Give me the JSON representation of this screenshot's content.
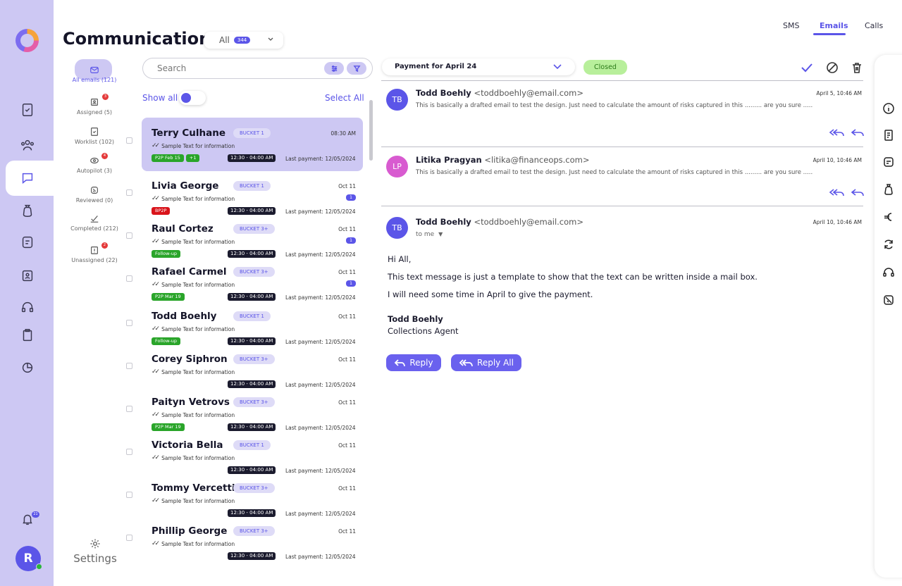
{
  "header": {
    "title": "Communication",
    "filter": {
      "value": "All",
      "count": "344"
    },
    "tabs": [
      {
        "label": "SMS",
        "active": false
      },
      {
        "label": "Emails",
        "active": true
      },
      {
        "label": "Calls",
        "active": false
      }
    ]
  },
  "rail": {
    "items": [
      "tasks-icon",
      "users-icon",
      "chat-icon",
      "money-bag-icon",
      "note-icon",
      "badge-icon",
      "headset-icon",
      "clipboard-icon",
      "pie-chart-icon"
    ],
    "active": "chat-icon",
    "notifications_count": "21",
    "user_initial": "R"
  },
  "folders": [
    {
      "label": "All emails (121)",
      "icon": "mail-icon",
      "active": true,
      "badge": ""
    },
    {
      "label": "Assigned (5)",
      "icon": "assigned-icon",
      "active": false,
      "badge": "3"
    },
    {
      "label": "Worklist (102)",
      "icon": "worklist-icon",
      "active": false,
      "badge": ""
    },
    {
      "label": "Autopilot (3)",
      "icon": "autopilot-icon",
      "active": false,
      "badge": "4"
    },
    {
      "label": "Reviewed (0)",
      "icon": "reviewed-icon",
      "active": false,
      "badge": ""
    },
    {
      "label": "Completed (212)",
      "icon": "check-icon",
      "active": false,
      "badge": ""
    },
    {
      "label": "Unassigned (22)",
      "icon": "unassigned-icon",
      "active": false,
      "badge": "2"
    }
  ],
  "settings_label": "Settings",
  "list": {
    "search_placeholder": "Search",
    "show_all_label": "Show all",
    "select_all_label": "Select All",
    "rows": [
      {
        "name": "Terry Culhane",
        "bucket": "BUCKET 1",
        "time": "08:30 AM",
        "subtitle": "Sample Text for information",
        "tags": [
          {
            "text": "P2P Feb 15",
            "color": "green"
          },
          {
            "text": "+1",
            "color": "green"
          }
        ],
        "slot": "12:30 - 04:00 AM",
        "last_payment": "Last payment: 12/05/2024",
        "unread": "",
        "active": true
      },
      {
        "name": "Livia George",
        "bucket": "BUCKET 1",
        "time": "Oct 11",
        "subtitle": "Sample Text for information",
        "tags": [
          {
            "text": "BP2P",
            "color": "red"
          }
        ],
        "slot": "12:30 - 04:00 AM",
        "last_payment": "Last payment: 12/05/2024",
        "unread": "1",
        "active": false
      },
      {
        "name": "Raul Cortez",
        "bucket": "BUCKET 3+",
        "time": "Oct 11",
        "subtitle": "Sample Text for information",
        "tags": [
          {
            "text": "Follow-up",
            "color": "green"
          }
        ],
        "slot": "12:30 - 04:00 AM",
        "last_payment": "Last payment: 12/05/2024",
        "unread": "1",
        "active": false
      },
      {
        "name": "Rafael Carmel",
        "bucket": "BUCKET 3+",
        "time": "Oct 11",
        "subtitle": "Sample Text for information",
        "tags": [
          {
            "text": "P2P Mar 19",
            "color": "green"
          }
        ],
        "slot": "12:30 - 04:00 AM",
        "last_payment": "Last payment: 12/05/2024",
        "unread": "1",
        "active": false
      },
      {
        "name": "Todd Boehly",
        "bucket": "BUCKET 1",
        "time": "Oct 11",
        "subtitle": "Sample Text for information",
        "tags": [
          {
            "text": "Follow-up",
            "color": "green"
          }
        ],
        "slot": "12:30 - 04:00 AM",
        "last_payment": "Last payment: 12/05/2024",
        "unread": "",
        "active": false
      },
      {
        "name": "Corey Siphron",
        "bucket": "BUCKET 3+",
        "time": "Oct 11",
        "subtitle": "Sample Text for information",
        "tags": [],
        "slot": "12:30 - 04:00 AM",
        "last_payment": "Last payment: 12/05/2024",
        "unread": "",
        "active": false
      },
      {
        "name": "Paityn Vetrovs",
        "bucket": "BUCKET 3+",
        "time": "Oct 11",
        "subtitle": "Sample Text for information",
        "tags": [
          {
            "text": "P2P Mar 19",
            "color": "green"
          }
        ],
        "slot": "12:30 - 04:00 AM",
        "last_payment": "Last payment: 12/05/2024",
        "unread": "",
        "active": false
      },
      {
        "name": "Victoria Bella",
        "bucket": "BUCKET 1",
        "time": "Oct 11",
        "subtitle": "Sample Text for information",
        "tags": [],
        "slot": "12:30 - 04:00 AM",
        "last_payment": "Last payment: 12/05/2024",
        "unread": "",
        "active": false
      },
      {
        "name": "Tommy Vercetti",
        "bucket": "BUCKET 3+",
        "time": "Oct 11",
        "subtitle": "Sample Text for information",
        "tags": [],
        "slot": "12:30 - 04:00 AM",
        "last_payment": "Last payment: 12/05/2024",
        "unread": "",
        "active": false
      },
      {
        "name": "Phillip George",
        "bucket": "BUCKET 3+",
        "time": "Oct 11",
        "subtitle": "Sample Text for information",
        "tags": [],
        "slot": "12:30 - 04:00 AM",
        "last_payment": "Last payment: 12/05/2024",
        "unread": "",
        "active": false
      }
    ]
  },
  "thread": {
    "subject": "Payment for April 24",
    "status": "Closed",
    "messages": [
      {
        "initials": "TB",
        "name": "Todd Boehly",
        "email": "<toddboehly@email.com>",
        "date": "April 5, 10:46 AM",
        "snippet": "This is basically a drafted email to test the design. Just need to calculate the amount of risks captured in this ......... are you sure .....",
        "color": "#5b55e8"
      },
      {
        "initials": "LP",
        "name": "Litika Pragyan",
        "email": "<litika@financeops.com>",
        "date": "April 10, 10:46 AM",
        "snippet": "This is basically a drafted email to test the design. Just need to calculate the amount of risks captured in this ......... are you sure .....",
        "color": "#d85bd0"
      }
    ],
    "open": {
      "initials": "TB",
      "name": "Todd Boehly",
      "email": "<toddboehly@email.com>",
      "date": "April 10, 10:46 AM",
      "to": "to me",
      "body": [
        "Hi All,",
        "This text message is just a template to show that the text can be written inside a mail box.",
        "I will need some time in April to give the payment."
      ],
      "signature_name": "Todd Boehly",
      "signature_role": "Collections Agent"
    },
    "reply_label": "Reply",
    "reply_all_label": "Reply All"
  },
  "right_rail": [
    "info-icon",
    "document-icon",
    "note-icon",
    "money-bag-icon",
    "euro-icon",
    "refresh-icon",
    "headset-icon",
    "no-phone-icon"
  ]
}
